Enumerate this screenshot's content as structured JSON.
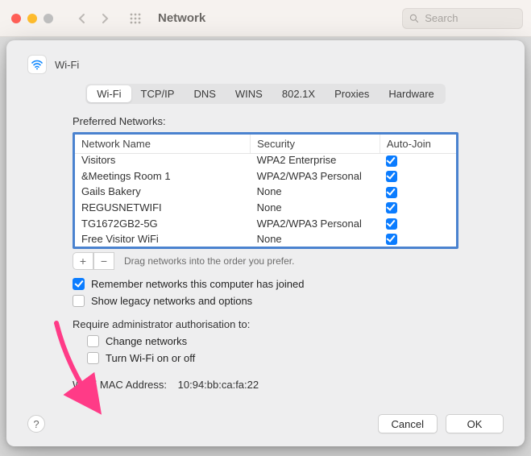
{
  "titlebar": {
    "title": "Network",
    "search_placeholder": "Search"
  },
  "sheet": {
    "title": "Wi-Fi",
    "tabs": [
      "Wi-Fi",
      "TCP/IP",
      "DNS",
      "WINS",
      "802.1X",
      "Proxies",
      "Hardware"
    ],
    "active_tab": 0,
    "preferred_label": "Preferred Networks:",
    "columns": {
      "name": "Network Name",
      "security": "Security",
      "autojoin": "Auto-Join"
    },
    "networks": [
      {
        "name": "Visitors",
        "security": "WPA2 Enterprise",
        "autojoin": true
      },
      {
        "name": "&Meetings Room 1",
        "security": "WPA2/WPA3 Personal",
        "autojoin": true
      },
      {
        "name": "Gails Bakery",
        "security": "None",
        "autojoin": true
      },
      {
        "name": "REGUSNETWIFI",
        "security": "None",
        "autojoin": true
      },
      {
        "name": "TG1672GB2-5G",
        "security": "WPA2/WPA3 Personal",
        "autojoin": true
      },
      {
        "name": "Free Visitor WiFi",
        "security": "None",
        "autojoin": true
      }
    ],
    "drag_hint": "Drag networks into the order you prefer.",
    "remember_label": "Remember networks this computer has joined",
    "remember_checked": true,
    "legacy_label": "Show legacy networks and options",
    "legacy_checked": false,
    "admin_label": "Require administrator authorisation to:",
    "admin_opts": {
      "change_label": "Change networks",
      "change_checked": false,
      "toggle_label": "Turn Wi-Fi on or off",
      "toggle_checked": false
    },
    "mac_label": "Wi-Fi MAC Address:",
    "mac_value": "10:94:bb:ca:fa:22",
    "buttons": {
      "cancel": "Cancel",
      "ok": "OK"
    }
  }
}
